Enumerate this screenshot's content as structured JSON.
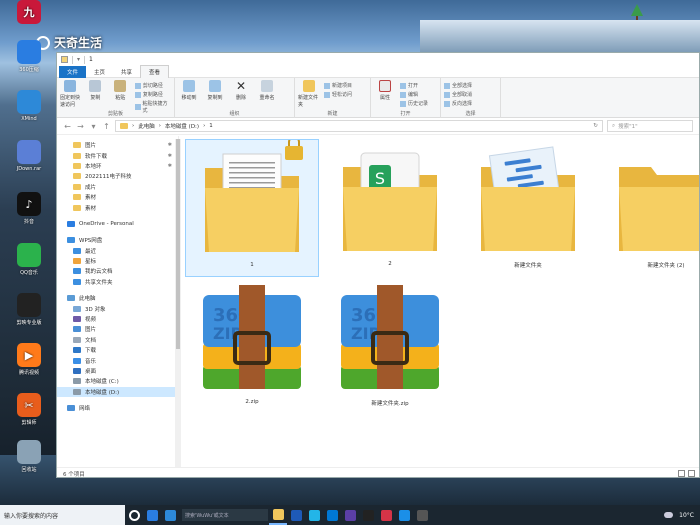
{
  "desktop": {
    "watermark": "天奇生活",
    "icons": [
      {
        "label": "",
        "color": "#c9183a",
        "glyph": "九",
        "name": "app-jiu-icon"
      },
      {
        "label": "360压缩",
        "color": "#2a7de1",
        "glyph": "",
        "name": "zip360-desktop-icon"
      },
      {
        "label": "XMind",
        "color": "#2d89d8",
        "glyph": "",
        "name": "xmind-desktop-icon"
      },
      {
        "label": "JDown.rar",
        "color": "#5b7fd6",
        "glyph": "",
        "name": "jdown-desktop-icon"
      },
      {
        "label": "抖音",
        "color": "#111111",
        "glyph": "♪",
        "name": "douyin-desktop-icon"
      },
      {
        "label": "QQ音乐",
        "color": "#2bb24c",
        "glyph": "",
        "name": "qqmusic-desktop-icon"
      },
      {
        "label": "剪映专业版",
        "color": "#222222",
        "glyph": "",
        "name": "jianying-desktop-icon"
      },
      {
        "label": "腾讯视频",
        "color": "#ff7a1a",
        "glyph": "▶",
        "name": "tencentvideo-desktop-icon"
      },
      {
        "label": "剪辑师",
        "color": "#e85d1c",
        "glyph": "✂",
        "name": "jianjishi-desktop-icon"
      },
      {
        "label": "回收站",
        "color": "#8aa2b5",
        "glyph": "",
        "name": "recycle-bin-icon"
      }
    ]
  },
  "window": {
    "title": "1",
    "tabs": [
      "文件",
      "主页",
      "共享",
      "查看"
    ],
    "ribbon": {
      "clipboard": {
        "pin": "固定到快速访问",
        "copy": "复制",
        "paste": "粘贴",
        "cut": "剪切路径",
        "copypath": "复制路径",
        "pasteshortcut": "粘贴快捷方式",
        "cut2": "剪切",
        "label": "剪贴板"
      },
      "organize": {
        "moveto": "移动到",
        "copyto": "复制到",
        "delete": "删除",
        "rename": "重命名",
        "label": "组织"
      },
      "new": {
        "newfolder": "新建文件夹",
        "newitem": "新建项目",
        "easyaccess": "轻松访问",
        "label": "新建"
      },
      "open": {
        "properties": "属性",
        "open": "打开",
        "edit": "编辑",
        "history": "历史记录",
        "label": "打开"
      },
      "select": {
        "all": "全部选择",
        "none": "全部取消",
        "invert": "反向选择",
        "label": "选择"
      }
    },
    "address": {
      "segments": [
        "此电脑",
        "本地磁盘 (D:)",
        "1"
      ],
      "search_placeholder": "搜索\"1\""
    },
    "nav": {
      "quick": [
        {
          "label": "图片",
          "pin": true
        },
        {
          "label": "软件下载",
          "pin": true
        },
        {
          "label": "本地环",
          "pin": true
        },
        {
          "label": "2022111电子科技",
          "pin": false
        },
        {
          "label": "成片",
          "pin": false
        },
        {
          "label": "素材",
          "pin": false
        },
        {
          "label": "素材",
          "pin": false
        }
      ],
      "onedrive": "OneDrive - Personal",
      "wps": "WPS网盘",
      "wps_items": [
        "最近",
        "星标",
        "我的云文档",
        "共享文件夹"
      ],
      "pc": "此电脑",
      "pc_items": [
        "3D 对象",
        "视频",
        "图片",
        "文档",
        "下载",
        "音乐",
        "桌面",
        "本地磁盘 (C:)",
        "本地磁盘 (D:)"
      ],
      "network": "网络"
    },
    "files": [
      {
        "name": "1",
        "kind": "doc-folder",
        "locked": true
      },
      {
        "name": "2",
        "kind": "sheet-folder",
        "locked": false
      },
      {
        "name": "新建文件夹",
        "kind": "flow-folder",
        "locked": false
      },
      {
        "name": "新建文件夹 (2)",
        "kind": "plain-folder",
        "locked": false
      },
      {
        "name": "2.zip",
        "kind": "zip",
        "locked": false
      },
      {
        "name": "新建文件夹.zip",
        "kind": "zip",
        "locked": false
      }
    ],
    "status": "6 个项目"
  },
  "taskbar": {
    "search_placeholder": "输入你要搜索的内容",
    "search2": "搜索'WuWu'或文本",
    "weather": "10°C",
    "colors": [
      "#ffffff",
      "#2a7de1",
      "#2d89d8",
      "#0a84d8",
      "#1ea14a",
      "#f2a93b",
      "#2bb24c",
      "#e53935",
      "#f0c65c",
      "#1e5ab8",
      "#23b5e8",
      "#0078d4",
      "#5b3fa5",
      "#222222",
      "#d63447",
      "#1b8fe8",
      "#555555"
    ]
  }
}
